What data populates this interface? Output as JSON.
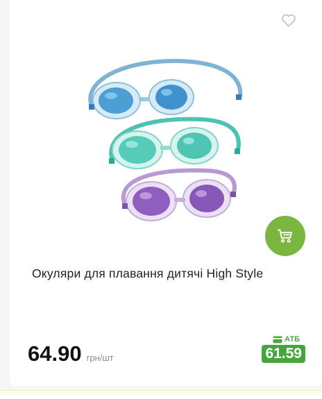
{
  "product": {
    "title": "Окуляри для плавання дитячі High Style",
    "price": "64.90",
    "unit": "грн/шт",
    "promo_label": "АТБ",
    "promo_price": "61.59"
  },
  "icons": {
    "favorite": "heart-icon",
    "cart": "cart-icon",
    "promo": "card-icon"
  },
  "colors": {
    "accent_green": "#7ab640",
    "promo_green": "#45a73a"
  }
}
